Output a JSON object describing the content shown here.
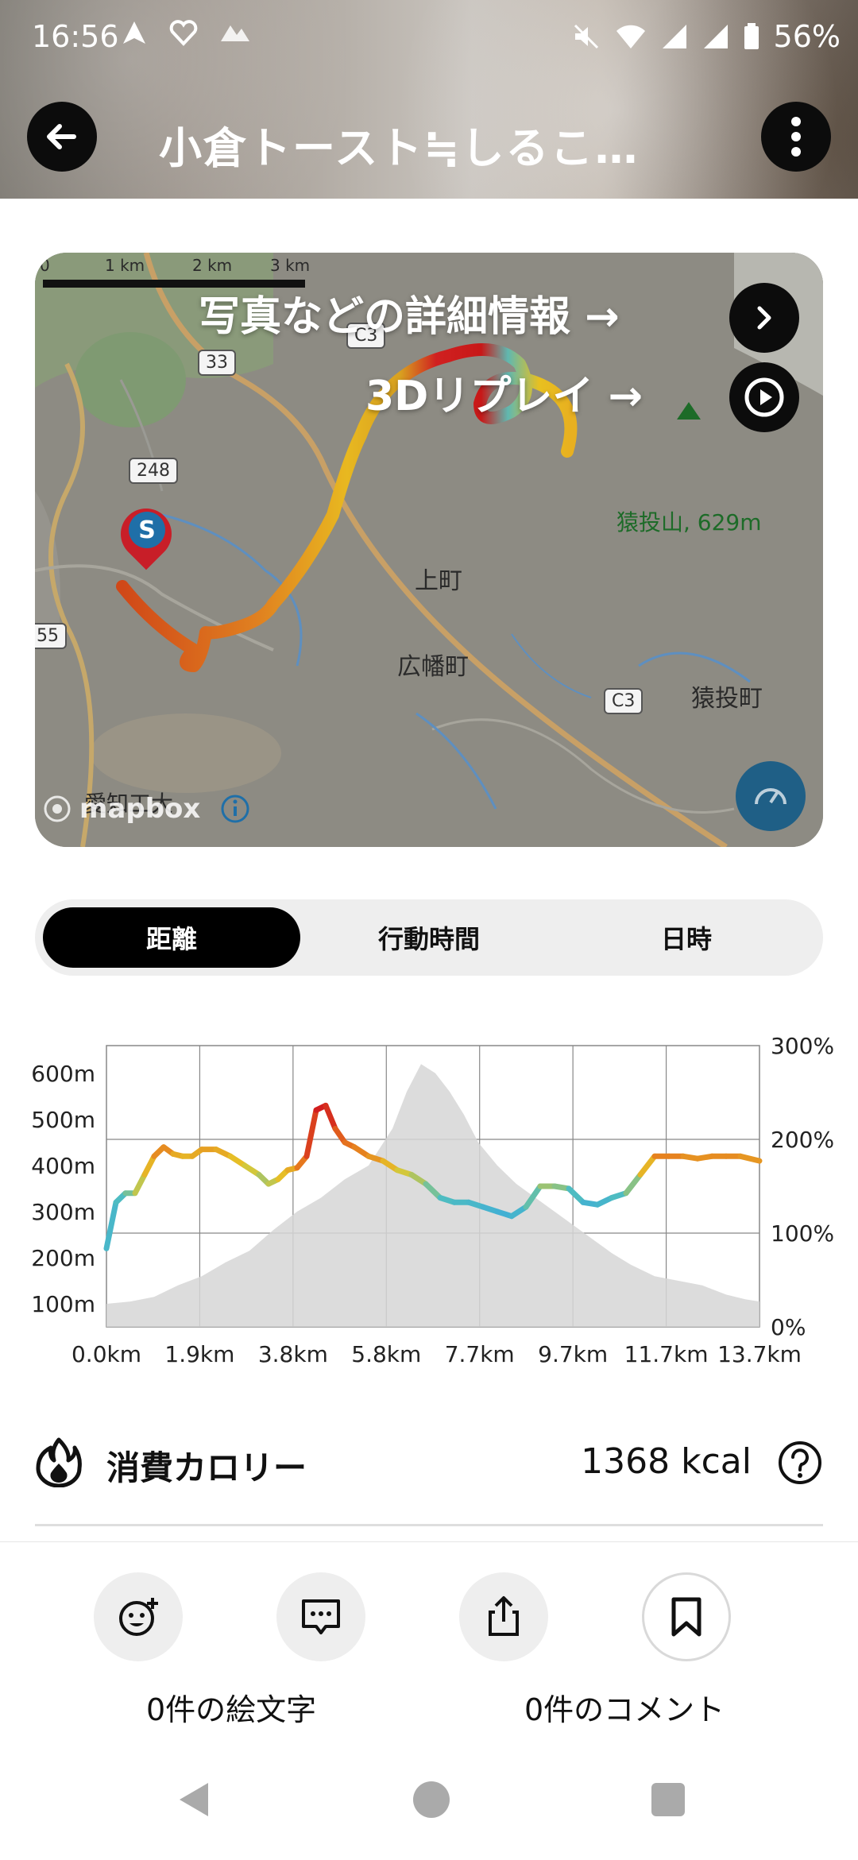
{
  "status_bar": {
    "time": "16:56",
    "battery": "56%",
    "icons": [
      "navigation-icon",
      "heart-icon",
      "mountain-icon",
      "mute-icon",
      "wifi-icon",
      "signal-icon",
      "signal-icon-2",
      "battery-icon"
    ]
  },
  "header": {
    "title": "小倉トースト≒しるこ…",
    "back_icon": "arrow-left-icon",
    "menu_icon": "more-vertical-icon"
  },
  "map": {
    "scale": [
      "0",
      "1 km",
      "2 km",
      "3 km"
    ],
    "detail_link": "写真などの詳細情報 →",
    "replay_link": "3Dリプレイ →",
    "summit_label": "猿投山, 629m",
    "places": [
      "上町",
      "広幡町",
      "猿投町",
      "愛知工大"
    ],
    "roads": [
      "33",
      "248",
      "C3",
      "C3",
      "55"
    ],
    "start_marker": "S",
    "attribution": "mapbox",
    "colors": {
      "route_high": "#d01818",
      "route_mid": "#e8c020",
      "route_low": "#3ab8c8"
    }
  },
  "segmented": {
    "options": [
      "距離",
      "行動時間",
      "日時"
    ],
    "active": "距離"
  },
  "chart_data": {
    "type": "line",
    "title": "",
    "x_ticks": [
      "0.0km",
      "1.9km",
      "3.8km",
      "5.8km",
      "7.7km",
      "9.7km",
      "11.7km",
      "13.7km"
    ],
    "y_left_ticks": [
      "600m",
      "500m",
      "400m",
      "300m",
      "200m",
      "100m"
    ],
    "y_right_ticks": [
      "300%",
      "200%",
      "100%",
      "0%"
    ],
    "xlim": [
      0,
      13.7
    ],
    "elevation_ylim": [
      50,
      660
    ],
    "grade_ylim": [
      0,
      300
    ],
    "grid": true,
    "series": [
      {
        "type": "area",
        "x": [
          0,
          0.5,
          1.0,
          1.5,
          2.0,
          2.5,
          3.0,
          3.5,
          4.0,
          4.5,
          5.0,
          5.5,
          6.0,
          6.3,
          6.6,
          6.9,
          7.2,
          7.5,
          7.8,
          8.2,
          8.6,
          9.0,
          9.4,
          9.8,
          10.2,
          10.6,
          11.0,
          11.5,
          12.0,
          12.5,
          13.0,
          13.4,
          13.7
        ],
        "y": [
          100,
          105,
          115,
          140,
          160,
          190,
          215,
          260,
          300,
          330,
          370,
          400,
          480,
          560,
          620,
          600,
          560,
          510,
          450,
          400,
          360,
          330,
          300,
          270,
          240,
          210,
          185,
          160,
          150,
          140,
          120,
          110,
          105
        ]
      },
      {
        "type": "line",
        "x": [
          0,
          0.2,
          0.4,
          0.6,
          0.8,
          1.0,
          1.2,
          1.4,
          1.6,
          1.8,
          2.0,
          2.3,
          2.6,
          2.9,
          3.2,
          3.4,
          3.6,
          3.8,
          4.0,
          4.2,
          4.4,
          4.6,
          4.8,
          5.0,
          5.2,
          5.5,
          5.8,
          6.1,
          6.4,
          6.7,
          7.0,
          7.3,
          7.6,
          7.9,
          8.2,
          8.5,
          8.8,
          9.1,
          9.4,
          9.7,
          10.0,
          10.3,
          10.6,
          10.9,
          11.2,
          11.5,
          11.8,
          12.1,
          12.4,
          12.7,
          13.0,
          13.3,
          13.7
        ],
        "y": [
          220,
          320,
          340,
          340,
          380,
          420,
          440,
          425,
          420,
          420,
          435,
          435,
          420,
          400,
          380,
          360,
          370,
          390,
          395,
          420,
          520,
          530,
          480,
          450,
          440,
          420,
          410,
          390,
          380,
          360,
          330,
          320,
          320,
          310,
          300,
          290,
          310,
          355,
          355,
          350,
          320,
          315,
          330,
          340,
          380,
          420,
          420,
          420,
          415,
          420,
          420,
          420,
          410
        ],
        "grade_pct": [
          20,
          30,
          40,
          60,
          80,
          100,
          120,
          100,
          90,
          90,
          100,
          100,
          90,
          80,
          70,
          60,
          80,
          90,
          100,
          140,
          200,
          210,
          160,
          130,
          120,
          110,
          100,
          80,
          70,
          60,
          40,
          30,
          30,
          20,
          15,
          10,
          30,
          60,
          60,
          50,
          20,
          15,
          30,
          40,
          70,
          110,
          120,
          110,
          105,
          110,
          110,
          110,
          100
        ]
      }
    ]
  },
  "calories": {
    "label": "消費カロリー",
    "value": "1368 kcal",
    "icon": "flame-icon",
    "help_icon": "help-circle-icon"
  },
  "actions": [
    {
      "icon": "add-emoji-icon",
      "name": "emoji"
    },
    {
      "icon": "comment-icon",
      "name": "comment"
    },
    {
      "icon": "share-icon",
      "name": "share"
    },
    {
      "icon": "bookmark-icon",
      "name": "bookmark"
    }
  ],
  "counts": {
    "emoji": "0件の絵文字",
    "comments": "0件のコメント"
  },
  "system_nav": [
    "back-icon",
    "home-icon",
    "recents-icon"
  ]
}
